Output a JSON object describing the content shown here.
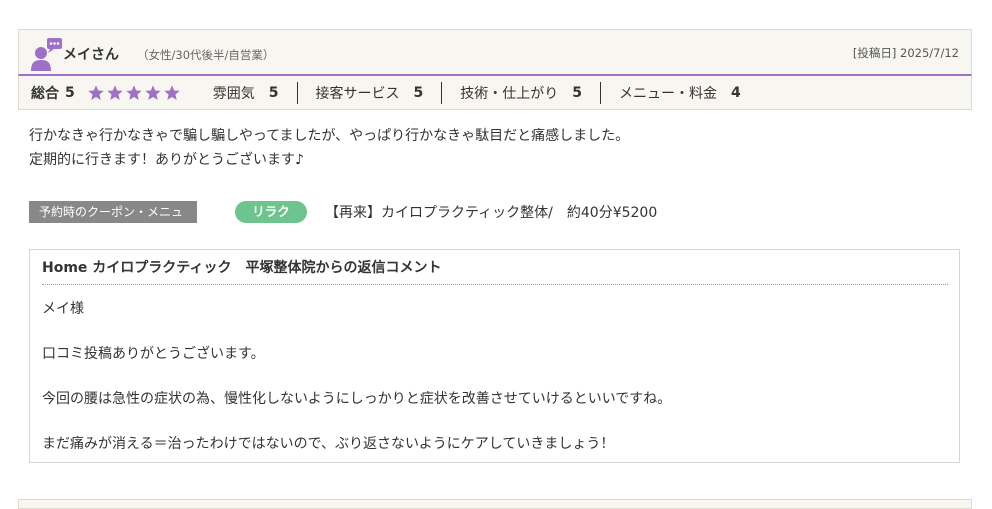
{
  "review": {
    "user": {
      "name": "メイさん",
      "info": "（女性/30代後半/自営業）",
      "avatar_icon": "user-speech-icon",
      "accent_color": "#9e70c8"
    },
    "post_date": "[投稿日] 2025/7/12",
    "ratings": {
      "total_label": "総合",
      "total_value": "5",
      "stars": 5,
      "star_color": "#9e70c8",
      "categories": [
        {
          "label": "雰囲気",
          "value": "5"
        },
        {
          "label": "接客サービス",
          "value": "5"
        },
        {
          "label": "技術・仕上がり",
          "value": "5"
        },
        {
          "label": "メニュー・料金",
          "value": "4"
        }
      ]
    },
    "body": {
      "line1": "行かなきゃ行かなきゃで騙し騙しやってましたが、やっぱり行かなきゃ駄目だと痛感しました。",
      "line2": "定期的に行きます！ありがとうございます♪"
    },
    "coupon": {
      "label": "予約時のクーポン・メニュー",
      "badge": "リラク",
      "badge_color": "#6ec48e",
      "text": "【再来】カイロプラクティック整体/　約40分¥5200"
    },
    "reply": {
      "title": "Home カイロプラクティック　平塚整体院からの返信コメント",
      "lines": [
        "メイ様",
        "口コミ投稿ありがとうございます。",
        "今回の腰は急性の症状の為、慢性化しないようにしっかりと症状を改善させていけるといいですね。",
        "まだ痛みが消える＝治ったわけではないので、ぶり返さないようにケアしていきましょう！"
      ]
    }
  }
}
